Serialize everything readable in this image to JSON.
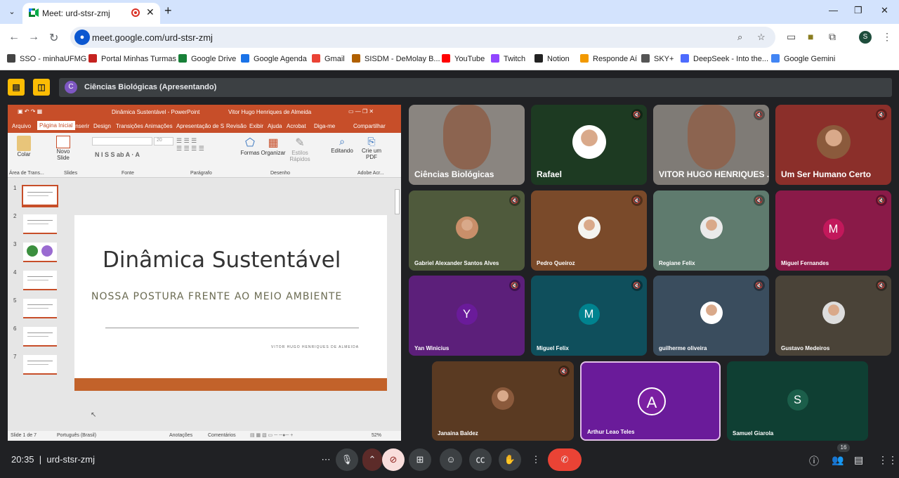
{
  "browser": {
    "tab_title": "Meet: urd-stsr-zmj",
    "url": "meet.google.com/urd-stsr-zmj",
    "window_controls": [
      "—",
      "❐",
      "✕"
    ],
    "bookmarks": [
      {
        "label": "SSO - minhaUFMG",
        "color": "#444"
      },
      {
        "label": "Portal Minhas Turmas",
        "color": "#c5221f"
      },
      {
        "label": "Google Drive",
        "color": "#188038"
      },
      {
        "label": "Google Agenda",
        "color": "#1a73e8"
      },
      {
        "label": "Gmail",
        "color": "#ea4335"
      },
      {
        "label": "SISDM - DeMolay B...",
        "color": "#b06000"
      },
      {
        "label": "YouTube",
        "color": "#ff0000"
      },
      {
        "label": "Twitch",
        "color": "#9146ff"
      },
      {
        "label": "Notion",
        "color": "#222"
      },
      {
        "label": "Responde Aí",
        "color": "#f29900"
      },
      {
        "label": "SKY+",
        "color": "#555"
      },
      {
        "label": "DeepSeek - Into the...",
        "color": "#4d6bfe"
      },
      {
        "label": "Google Gemini",
        "color": "#4285f4"
      }
    ],
    "profile_letter": "S"
  },
  "meet": {
    "presenting_label": "Ciências Biológicas (Apresentando)",
    "presenter_initial": "C",
    "clock": "20:35",
    "meeting_code": "urd-stsr-zmj",
    "participant_count": "16"
  },
  "powerpoint": {
    "title": "Dinâmica Sustentável  -  PowerPoint",
    "user": "Vitor Hugo Henriques de Almeida",
    "ribbon_tabs": [
      "Arquivo",
      "Página Inicial",
      "Inserir",
      "Design",
      "Transições",
      "Animações",
      "Apresentação de S",
      "Revisão",
      "Exibir",
      "Ajuda",
      "Acrobat",
      "Diga-me",
      "Compartilhar"
    ],
    "ribbon_buttons": {
      "paste": "Colar",
      "new_slide": "Novo Slide",
      "shapes": "Formas",
      "arrange": "Organizar",
      "quick_styles": "Estilos Rápidos",
      "editing": "Editando",
      "create_pdf": "Crie um PDF",
      "font_size": "20"
    },
    "ribbon_groups": [
      "Área de Trans...",
      "Slides",
      "Fonte",
      "Parágrafo",
      "Desenho",
      "Adobe Acr..."
    ],
    "slide_numbers": [
      "1",
      "2",
      "3",
      "4",
      "5",
      "6",
      "7"
    ],
    "slide": {
      "title": "Dinâmica Sustentável",
      "subtitle": "NOSSA POSTURA FRENTE AO MEIO AMBIENTE",
      "author": "VITOR HUGO HENRIQUES DE ALMEIDA"
    },
    "status": {
      "slide_pos": "Slide 1 de 7",
      "language": "Português (Brasil)",
      "notes": "Anotações",
      "comments": "Comentários",
      "zoom": "52%"
    }
  },
  "participants": [
    {
      "name": "Ciências Biológicas",
      "bg": "#8a8580",
      "muted": false
    },
    {
      "name": "Rafael",
      "bg": "#1d3a22",
      "muted": true
    },
    {
      "name": "VITOR HUGO HENRIQUES ...",
      "bg": "#7f7b76",
      "muted": true
    },
    {
      "name": "Um Ser Humano Certo",
      "bg": "#8b2f2a",
      "muted": true
    },
    {
      "name": "Gabriel Alexander Santos Alves",
      "bg": "#4f5a3c",
      "muted": true
    },
    {
      "name": "Pedro Queiroz",
      "bg": "#7a4a2a",
      "muted": true
    },
    {
      "name": "Regiane Felix",
      "bg": "#5f7b6e",
      "muted": true
    },
    {
      "name": "Miguel Fernandes",
      "bg": "#8a1a48",
      "muted": true,
      "initial": "M",
      "avatar": "#c2185b"
    },
    {
      "name": "Yan Winicius",
      "bg": "#5c1f7a",
      "muted": true,
      "initial": "Y",
      "avatar": "#6a1b9a"
    },
    {
      "name": "Miguel Felix",
      "bg": "#0f4f5c",
      "muted": true,
      "initial": "M",
      "avatar": "#00838f"
    },
    {
      "name": "guilherme oliveira",
      "bg": "#3a4d5e",
      "muted": true
    },
    {
      "name": "Gustavo Medeiros",
      "bg": "#4a4338",
      "muted": true
    },
    {
      "name": "Janaina Baldez",
      "bg": "#5a3a22",
      "muted": true
    },
    {
      "name": "Arthur Leao Teles",
      "bg": "#6a1b9a",
      "muted": false,
      "initial": "A",
      "avatar": "#7b1fa2"
    },
    {
      "name": "Samuel Giarola",
      "bg": "#0f3f33",
      "muted": false,
      "initial": "S",
      "avatar": "#1b5e4a"
    }
  ]
}
